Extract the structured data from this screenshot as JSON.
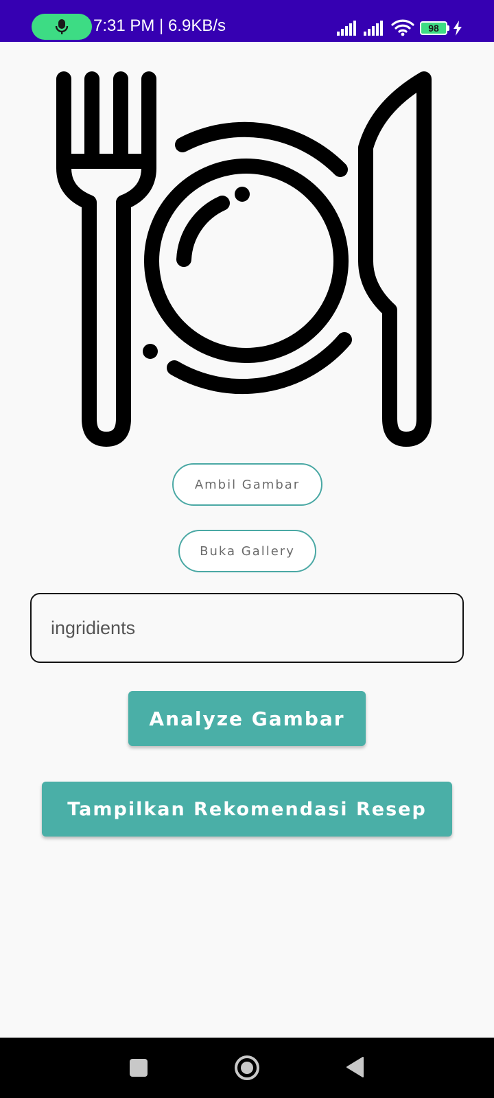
{
  "status_bar": {
    "time": "7:31 PM | 6.9KB/s",
    "battery": "98",
    "icons": [
      "mic-icon",
      "signal-icon",
      "signal-icon",
      "wifi-icon",
      "battery-icon",
      "charging-icon"
    ]
  },
  "colors": {
    "status_bar": "#3600b2",
    "accent": "#4aafa7",
    "mic_pill": "#3ddc84",
    "background": "#f9f9f9"
  },
  "logo": {
    "icon": "fork-plate-knife-icon"
  },
  "buttons": {
    "ambil_gambar": "Ambil Gambar",
    "buka_gallery": "Buka Gallery",
    "analyze": "Analyze Gambar",
    "tampilkan": "Tampilkan Rekomendasi Resep"
  },
  "input": {
    "value": "ingridients"
  },
  "nav_bar": {
    "icons": [
      "recents-icon",
      "home-icon",
      "back-icon"
    ]
  }
}
